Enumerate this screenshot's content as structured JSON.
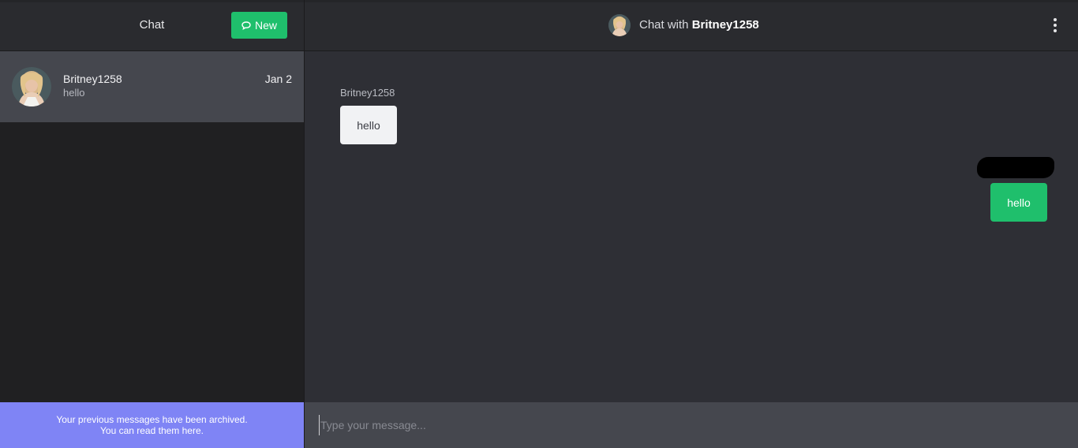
{
  "sidebar": {
    "title": "Chat",
    "new_button": {
      "label": "New",
      "icon": "chat-bubble-icon"
    },
    "conversations": [
      {
        "name": "Britney1258",
        "preview": "hello",
        "date": "Jan 2",
        "avatar": "user-avatar"
      }
    ],
    "archive_banner": {
      "line1": "Your previous messages have been archived.",
      "line2": "You can read them here."
    }
  },
  "header": {
    "prefix": "Chat with",
    "username": "Britney1258",
    "menu_icon": "kebab-menu-icon"
  },
  "messages": [
    {
      "direction": "incoming",
      "sender": "Britney1258",
      "text": "hello"
    },
    {
      "direction": "outgoing",
      "sender": "",
      "text": "hello"
    }
  ],
  "composer": {
    "placeholder": "Type your message..."
  },
  "colors": {
    "accent": "#1fbf6c",
    "banner": "#7f84f5",
    "selected_row": "#45474e",
    "sidebar_bg": "#202022",
    "main_bg": "#2e2f35"
  }
}
